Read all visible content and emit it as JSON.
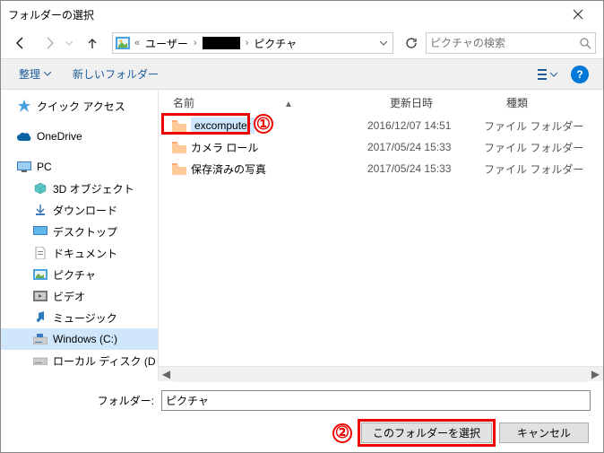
{
  "title": "フォルダーの選択",
  "breadcrumb": {
    "u": "ユーザー",
    "p": "ピクチャ"
  },
  "search": {
    "placeholder": "ピクチャの検索"
  },
  "toolbar": {
    "organize": "整理",
    "newfolder": "新しいフォルダー"
  },
  "headers": {
    "name": "名前",
    "date": "更新日時",
    "type": "種類"
  },
  "tree": {
    "quick": "クイック アクセス",
    "onedrive": "OneDrive",
    "pc": "PC",
    "obj3d": "3D オブジェクト",
    "downloads": "ダウンロード",
    "desktop": "デスクトップ",
    "documents": "ドキュメント",
    "pictures": "ピクチャ",
    "videos": "ビデオ",
    "music": "ミュージック",
    "windows": "Windows (C:)",
    "local": "ローカル ディスク (D"
  },
  "rows": [
    {
      "name": "excomputer",
      "date": "2016/12/07 14:51",
      "type": "ファイル フォルダー"
    },
    {
      "name": "カメラ ロール",
      "date": "2017/05/24 15:33",
      "type": "ファイル フォルダー"
    },
    {
      "name": "保存済みの写真",
      "date": "2017/05/24 15:33",
      "type": "ファイル フォルダー"
    }
  ],
  "footer": {
    "label": "フォルダー:",
    "value": "ピクチャ",
    "select": "このフォルダーを選択",
    "cancel": "キャンセル"
  },
  "annot": {
    "one": "①",
    "two": "②"
  }
}
